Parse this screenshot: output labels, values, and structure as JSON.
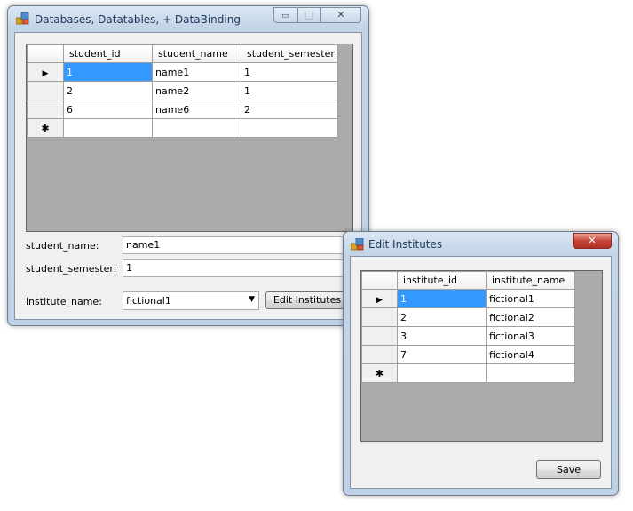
{
  "main_window": {
    "title": "Databases, Datatables, + DataBinding",
    "minimize_glyph": "▭",
    "maximize_glyph": "□",
    "close_glyph": "✕",
    "grid": {
      "columns": [
        "student_id",
        "student_name",
        "student_semester"
      ],
      "rows": [
        [
          "1",
          "name1",
          "1"
        ],
        [
          "2",
          "name2",
          "1"
        ],
        [
          "6",
          "name6",
          "2"
        ]
      ],
      "current_row_glyph": "▶",
      "new_row_glyph": "✱"
    },
    "form": {
      "student_name_label": "student_name:",
      "student_name_value": "name1",
      "student_semester_label": "student_semester:",
      "student_semester_value": "1",
      "institute_name_label": "institute_name:",
      "institute_name_value": "fictional1",
      "edit_institutes_button": "Edit Institutes"
    }
  },
  "dialog": {
    "title": "Edit Institutes",
    "close_glyph": "✕",
    "grid": {
      "columns": [
        "institute_id",
        "institute_name"
      ],
      "rows": [
        [
          "1",
          "fictional1"
        ],
        [
          "2",
          "fictional2"
        ],
        [
          "3",
          "fictional3"
        ],
        [
          "7",
          "fictional4"
        ]
      ],
      "current_row_glyph": "▶",
      "new_row_glyph": "✱"
    },
    "save_button": "Save"
  },
  "colors": {
    "selection": "#3399ff",
    "grid_background": "#ababab",
    "close_button": "#c7443a"
  }
}
